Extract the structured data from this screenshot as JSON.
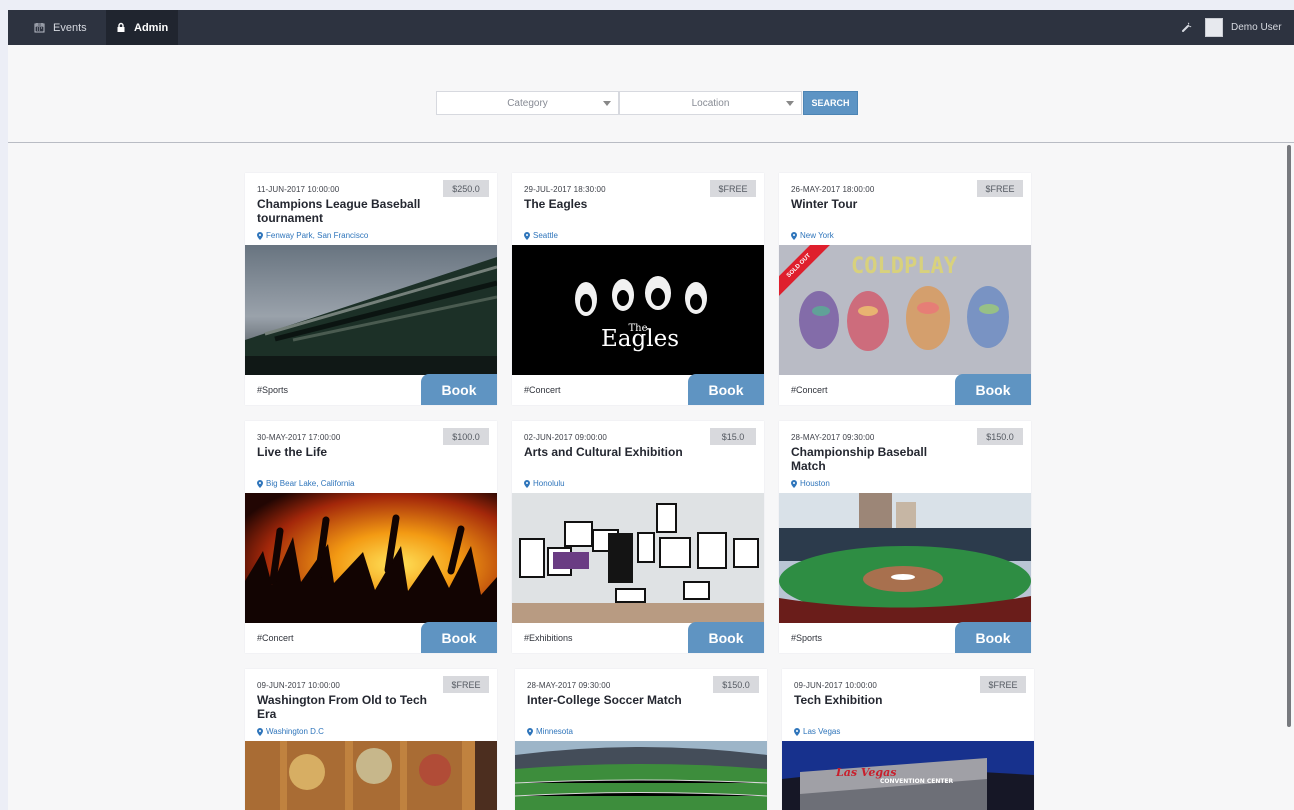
{
  "app": {
    "nav": [
      {
        "label": "Events",
        "icon": "calendar-icon"
      },
      {
        "label": "Admin",
        "icon": "lock-icon"
      }
    ],
    "user": {
      "name": "Demo User",
      "settings_icon": "wrench-icon",
      "avatar": "avatar-icon"
    },
    "search": {
      "category_placeholder": "Category",
      "location_placeholder": "Location",
      "button_label": "SEARCH"
    },
    "colors": {
      "topbar": "#2d3340",
      "accent": "#5d94c4",
      "location_text": "#2f75bb",
      "sold_out": "#df1f2d"
    }
  },
  "events": [
    {
      "date": "11-JUN-2017 10:00:00",
      "title": "Champions League Baseball tournament",
      "price": "$250.0",
      "location": "Fenway Park, San Francisco",
      "tag": "#Sports",
      "book": "Book",
      "image": "baseball-stadium-image"
    },
    {
      "date": "29-JUL-2017 18:30:00",
      "title": "The Eagles",
      "price": "$FREE",
      "location": "Seattle",
      "tag": "#Concert",
      "book": "Book",
      "image": "eagles-image",
      "image_text": [
        "The",
        "Eagles"
      ]
    },
    {
      "date": "26-MAY-2017 18:00:00",
      "title": "Winter Tour",
      "price": "$FREE",
      "location": "New York",
      "tag": "#Concert",
      "book": "Book",
      "image": "coldplay-image",
      "image_text": "COLDPLAY",
      "status": "SOLD OUT"
    },
    {
      "date": "30-MAY-2017 17:00:00",
      "title": "Live the Life",
      "price": "$100.0",
      "location": "Big Bear Lake, California",
      "tag": "#Concert",
      "book": "Book",
      "image": "concert-crowd-image"
    },
    {
      "date": "02-JUN-2017 09:00:00",
      "title": "Arts and Cultural Exhibition",
      "price": "$15.0",
      "location": "Honolulu",
      "tag": "#Exhibitions",
      "book": "Book",
      "image": "gallery-wall-image"
    },
    {
      "date": "28-MAY-2017 09:30:00",
      "title": "Championship Baseball Match",
      "price": "$150.0",
      "location": "Houston",
      "tag": "#Sports",
      "book": "Book",
      "image": "houston-ballpark-image"
    },
    {
      "date": "09-JUN-2017 10:00:00",
      "title": "Washington From Old to Tech Era",
      "price": "$FREE",
      "location": "Washington D.C",
      "image": "mural-image"
    },
    {
      "date": "28-MAY-2017 09:30:00",
      "title": "Inter-College Soccer Match",
      "price": "$150.0",
      "location": "Minnesota",
      "image": "soccer-stadium-image"
    },
    {
      "date": "09-JUN-2017 10:00:00",
      "title": "Tech Exhibition",
      "price": "$FREE",
      "location": "Las Vegas",
      "image": "convention-center-image",
      "image_text": [
        "Las Vegas",
        "CONVENTION CENTER"
      ]
    }
  ]
}
